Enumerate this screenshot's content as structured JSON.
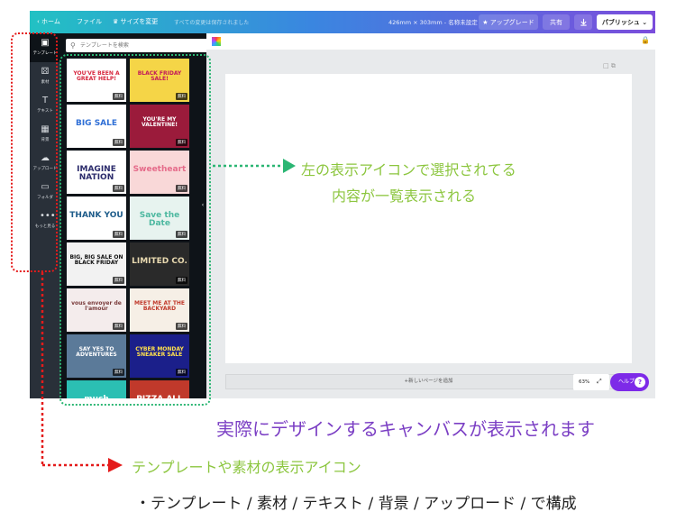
{
  "topbar": {
    "home_label": "‹  ホーム",
    "file_label": "ファイル",
    "resize_label": "♛ サイズを変更",
    "saved_status": "すべての変更は保存されました",
    "design_size": "426mm × 303mm - 名称未設定",
    "upgrade_label": "★ アップグレード",
    "share_label": "共有",
    "publish_label": "パブリッシュ  ⌄"
  },
  "rail": {
    "items": [
      {
        "label": "テンプレート",
        "icon": "▣"
      },
      {
        "label": "素材",
        "icon": "⚄"
      },
      {
        "label": "テキスト",
        "icon": "T"
      },
      {
        "label": "背景",
        "icon": "▦"
      },
      {
        "label": "アップロード",
        "icon": "☁"
      },
      {
        "label": "フォルダ",
        "icon": "▭"
      },
      {
        "label": "もっと見る",
        "icon": "•••"
      }
    ]
  },
  "panel": {
    "search_placeholder": "テンプレートを検索",
    "badge_label": "無料",
    "templates": [
      {
        "title": "YOU'VE BEEN A GREAT HELP!",
        "bg": "#ffffff",
        "fg": "#d7263d"
      },
      {
        "title": "BLACK FRIDAY SALE!",
        "bg": "#f5d547",
        "fg": "#c2185b"
      },
      {
        "title": "BIG SALE",
        "bg": "#ffffff",
        "fg": "#2f6fd6"
      },
      {
        "title": "YOU'RE MY VALENTINE!",
        "bg": "#9b1b3b",
        "fg": "#ffffff"
      },
      {
        "title": "IMAGINE NATION",
        "bg": "#ffffff",
        "fg": "#2b2b6b"
      },
      {
        "title": "Sweetheart",
        "bg": "#f9d8d8",
        "fg": "#e56b8a"
      },
      {
        "title": "THANK YOU",
        "bg": "#ffffff",
        "fg": "#1e5c8a"
      },
      {
        "title": "Save the Date",
        "bg": "#e7f3ef",
        "fg": "#4db8a0"
      },
      {
        "title": "BIG, BIG SALE ON BLACK FRIDAY",
        "bg": "#f2f2f2",
        "fg": "#111111"
      },
      {
        "title": "LIMITED CO.",
        "bg": "#2a2a2a",
        "fg": "#e8d9b0"
      },
      {
        "title": "vous envoyer de l'amour",
        "bg": "#f4ecec",
        "fg": "#7a3b3b"
      },
      {
        "title": "MEET ME AT THE BACKYARD",
        "bg": "#f6efe6",
        "fg": "#c0392b"
      },
      {
        "title": "SAY YES TO ADVENTURES",
        "bg": "#5b7a99",
        "fg": "#ffffff"
      },
      {
        "title": "CYBER MONDAY SNEAKER SALE",
        "bg": "#1b1f8a",
        "fg": "#ffe14d"
      },
      {
        "title": "much",
        "bg": "#2bbfb3",
        "fg": "#ffffff"
      },
      {
        "title": "PIZZA ALL",
        "bg": "#c0392b",
        "fg": "#ffffff"
      }
    ]
  },
  "canvas": {
    "add_page_label": "+新しいページを追加",
    "zoom_value": "63%",
    "help_label": "ヘルプ",
    "help_q": "?"
  },
  "annotations": {
    "panel_note_line1": "左の表示アイコンで選択されてる",
    "panel_note_line2": "内容が一覧表示される",
    "canvas_note": "実際にデザインするキャンバスが表示されます",
    "rail_note": "テンプレートや素材の表示アイコン",
    "composition_note": "・テンプレート / 素材 / テキスト / 背景 / アップロード / で構成"
  },
  "colors": {
    "annotation_red": "#e41b1b",
    "annotation_green": "#2bb673",
    "help_purple": "#7d2ae8"
  }
}
